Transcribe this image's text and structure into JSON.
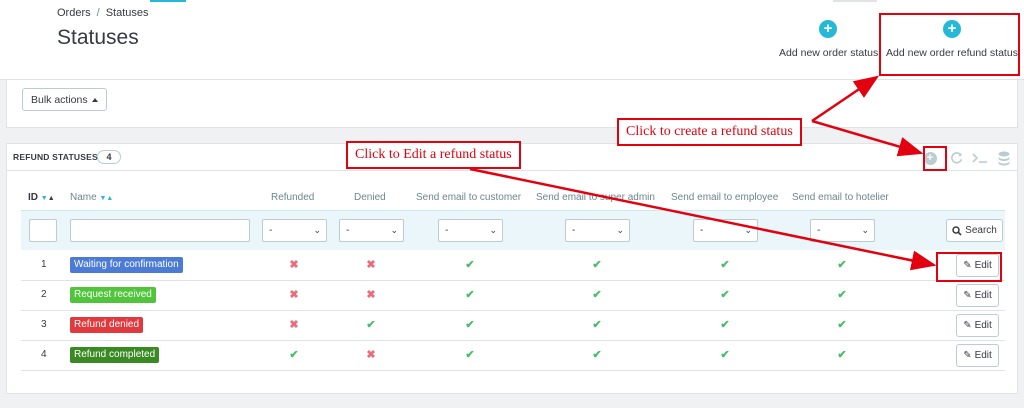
{
  "breadcrumb": {
    "parent": "Orders",
    "separator": "/",
    "current": "Statuses"
  },
  "page_title": "Statuses",
  "toolbar": {
    "add_order_status": "Add new order status",
    "add_refund_status": "Add new order refund status",
    "plus_glyph": "+"
  },
  "bulk": {
    "label": "Bulk actions"
  },
  "panel": {
    "title": "REFUND STATUSES",
    "count": "4"
  },
  "columns": {
    "id": "ID",
    "name": "Name",
    "refunded": "Refunded",
    "denied": "Denied",
    "email_customer": "Send email to customer",
    "email_admin": "Send email to super admin",
    "email_employee": "Send email to employee",
    "email_hotelier": "Send email to hotelier",
    "sort_down": "▼",
    "sort_up": "▲"
  },
  "filters": {
    "select_value": "-",
    "search_label": "Search"
  },
  "rows": [
    {
      "id": "1",
      "name": "Waiting for confirmation",
      "color": "#4c7bd6",
      "refunded": false,
      "denied": false,
      "customer": true,
      "admin": true,
      "employee": true,
      "hotelier": true
    },
    {
      "id": "2",
      "name": "Request received",
      "color": "#50c43b",
      "refunded": false,
      "denied": false,
      "customer": true,
      "admin": true,
      "employee": true,
      "hotelier": true
    },
    {
      "id": "3",
      "name": "Refund denied",
      "color": "#e0393e",
      "refunded": false,
      "denied": true,
      "customer": true,
      "admin": true,
      "employee": true,
      "hotelier": true
    },
    {
      "id": "4",
      "name": "Refund completed",
      "color": "#3a8a24",
      "refunded": true,
      "denied": false,
      "customer": true,
      "admin": true,
      "employee": true,
      "hotelier": true
    }
  ],
  "row_actions": {
    "edit_label": "Edit"
  },
  "annotations": {
    "create_refund": "Click to create a refund status",
    "edit_refund": "Click to Edit a refund status"
  },
  "icons": [
    "plus-circle-icon",
    "refresh-icon",
    "terminal-icon",
    "database-icon",
    "search-icon",
    "pencil-icon",
    "check-icon",
    "cross-icon"
  ],
  "colors": {
    "accent": "#25b9d7",
    "annotation": "#e3000f",
    "check": "#4cbb6c",
    "cross": "#e76d7a"
  }
}
